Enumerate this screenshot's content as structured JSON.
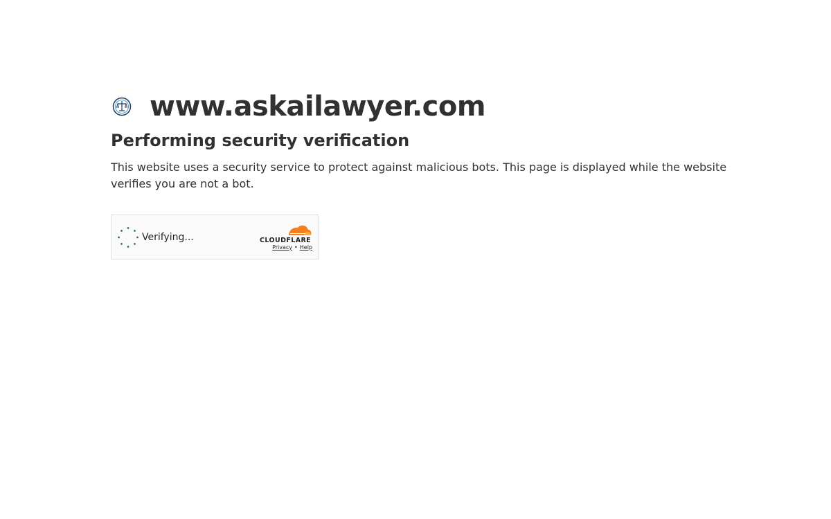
{
  "site": {
    "name": "www.askailawyer.com",
    "favicon": "scales-of-justice-icon"
  },
  "heading": "Performing security verification",
  "description": "This website uses a security service to protect against malicious bots. This page is displayed while the website verifies you are not a bot.",
  "widget": {
    "status": "Verifying...",
    "brand": "CLOUDFLARE",
    "privacy_label": "Privacy",
    "separator": "•",
    "help_label": "Help",
    "spinner_color": "#2c7a3a",
    "brand_orange": "#f38020",
    "brand_light_orange": "#faae40"
  }
}
